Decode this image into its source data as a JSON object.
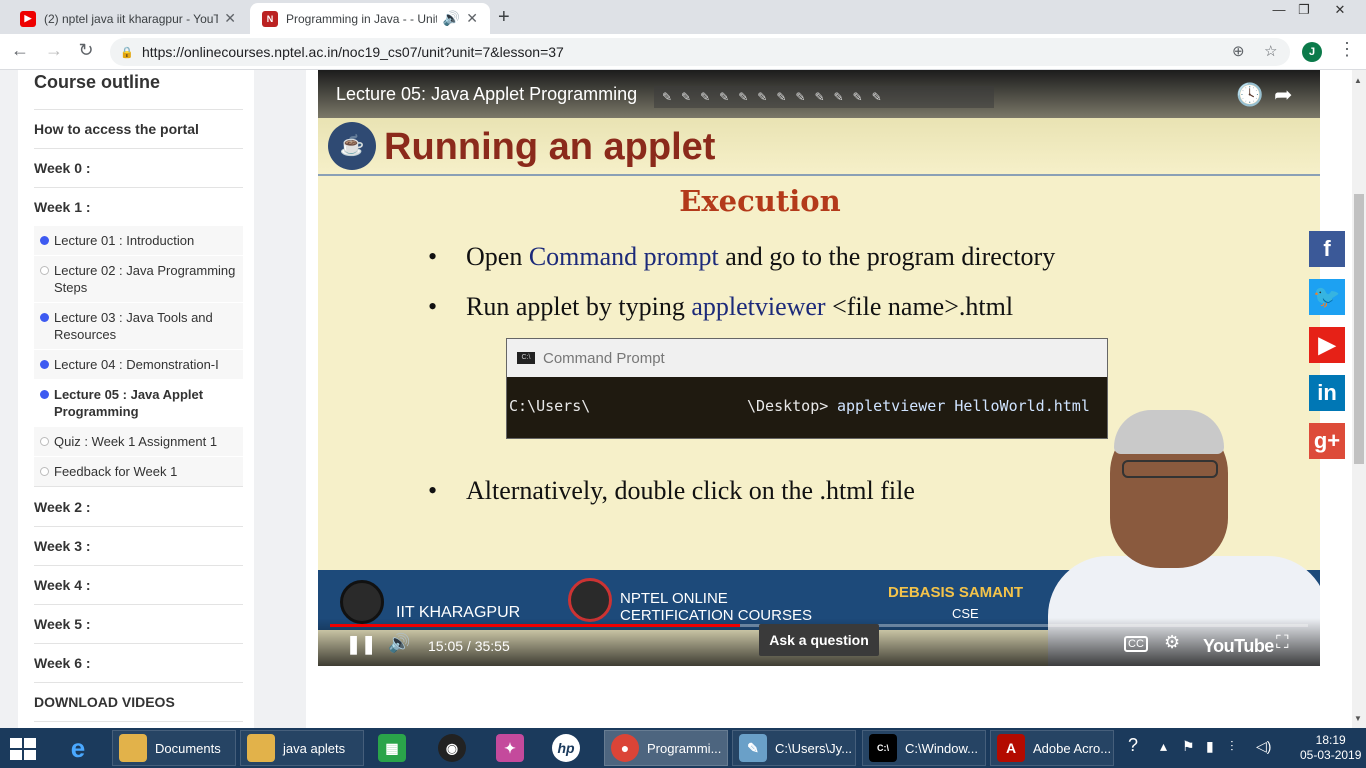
{
  "browser": {
    "tabs": [
      {
        "title": "(2) nptel java iit kharagpur - YouT",
        "icon": "youtube-favicon"
      },
      {
        "title": "Programming in Java - - Unit",
        "icon": "nptel-favicon"
      }
    ],
    "url": "https://onlinecourses.nptel.ac.in/noc19_cs07/unit?unit=7&lesson=37",
    "profile_initial": "J"
  },
  "sidebar": {
    "title": "Course outline",
    "rows_top": [
      {
        "label": "How to access the portal"
      },
      {
        "label": "Week 0 :"
      },
      {
        "label": "Week 1 :"
      }
    ],
    "lessons": [
      {
        "label": "Lecture 01 : Introduction",
        "status": "filled"
      },
      {
        "label": "Lecture 02 : Java Programming Steps",
        "status": "empty"
      },
      {
        "label": "Lecture 03 : Java Tools and Resources",
        "status": "filled"
      },
      {
        "label": "Lecture 04 : Demonstration-I",
        "status": "filled"
      },
      {
        "label": "Lecture 05 : Java Applet Programming",
        "status": "filled",
        "current": true
      },
      {
        "label": "Quiz : Week 1 Assignment 1",
        "status": "empty"
      },
      {
        "label": "Feedback for Week 1",
        "status": "empty"
      }
    ],
    "rows_bottom": [
      {
        "label": "Week 2 :"
      },
      {
        "label": "Week 3 :"
      },
      {
        "label": "Week 4 :"
      },
      {
        "label": "Week 5 :"
      },
      {
        "label": "Week 6 :"
      },
      {
        "label": "DOWNLOAD VIDEOS"
      }
    ]
  },
  "video": {
    "title": "Lecture 05: Java Applet Programming",
    "slide": {
      "heading": "Running an applet",
      "subheading": "Execution",
      "bullet1_pre": "Open ",
      "bullet1_hl": "Command prompt",
      "bullet1_post": " and go to the program directory",
      "bullet2_pre": "Run applet by typing ",
      "bullet2_hl": "appletviewer",
      "bullet2_post": " <file name>.html",
      "bullet3": "Alternatively, double click on the .html file",
      "cmd_title": "Command Prompt",
      "cmd_left": "C:\\Users\\",
      "cmd_mid": "\\Desktop>",
      "cmd_hl": "appletviewer HelloWorld.html"
    },
    "footer": {
      "iit": "IIT KHARAGPUR",
      "nptel_line1": "NPTEL ONLINE",
      "nptel_line2": "CERTIFICATION COURSES",
      "presenter": "DEBASIS SAMANT",
      "dept": "CSE"
    },
    "time": "15:05 / 35:55",
    "progress_fraction": 0.419,
    "brand": "YouTube"
  },
  "social": [
    {
      "icon": "facebook-icon",
      "glyph": "f",
      "color": "#3b5998"
    },
    {
      "icon": "twitter-icon",
      "glyph": "🐦",
      "color": "#1da1f2"
    },
    {
      "icon": "youtube-icon",
      "glyph": "▶",
      "color": "#e62117"
    },
    {
      "icon": "linkedin-icon",
      "glyph": "in",
      "color": "#0077b5"
    },
    {
      "icon": "googleplus-icon",
      "glyph": "g+",
      "color": "#dd4b39"
    }
  ],
  "ask_button": "Ask a question",
  "taskbar": {
    "apps": [
      {
        "label": "Documents"
      },
      {
        "label": "java aplets"
      },
      {
        "label": "Programmi..."
      },
      {
        "label": "C:\\Users\\Jy..."
      },
      {
        "label": "C:\\Window..."
      },
      {
        "label": "Adobe Acro..."
      }
    ],
    "time": "18:19",
    "date": "05-03-2019"
  }
}
